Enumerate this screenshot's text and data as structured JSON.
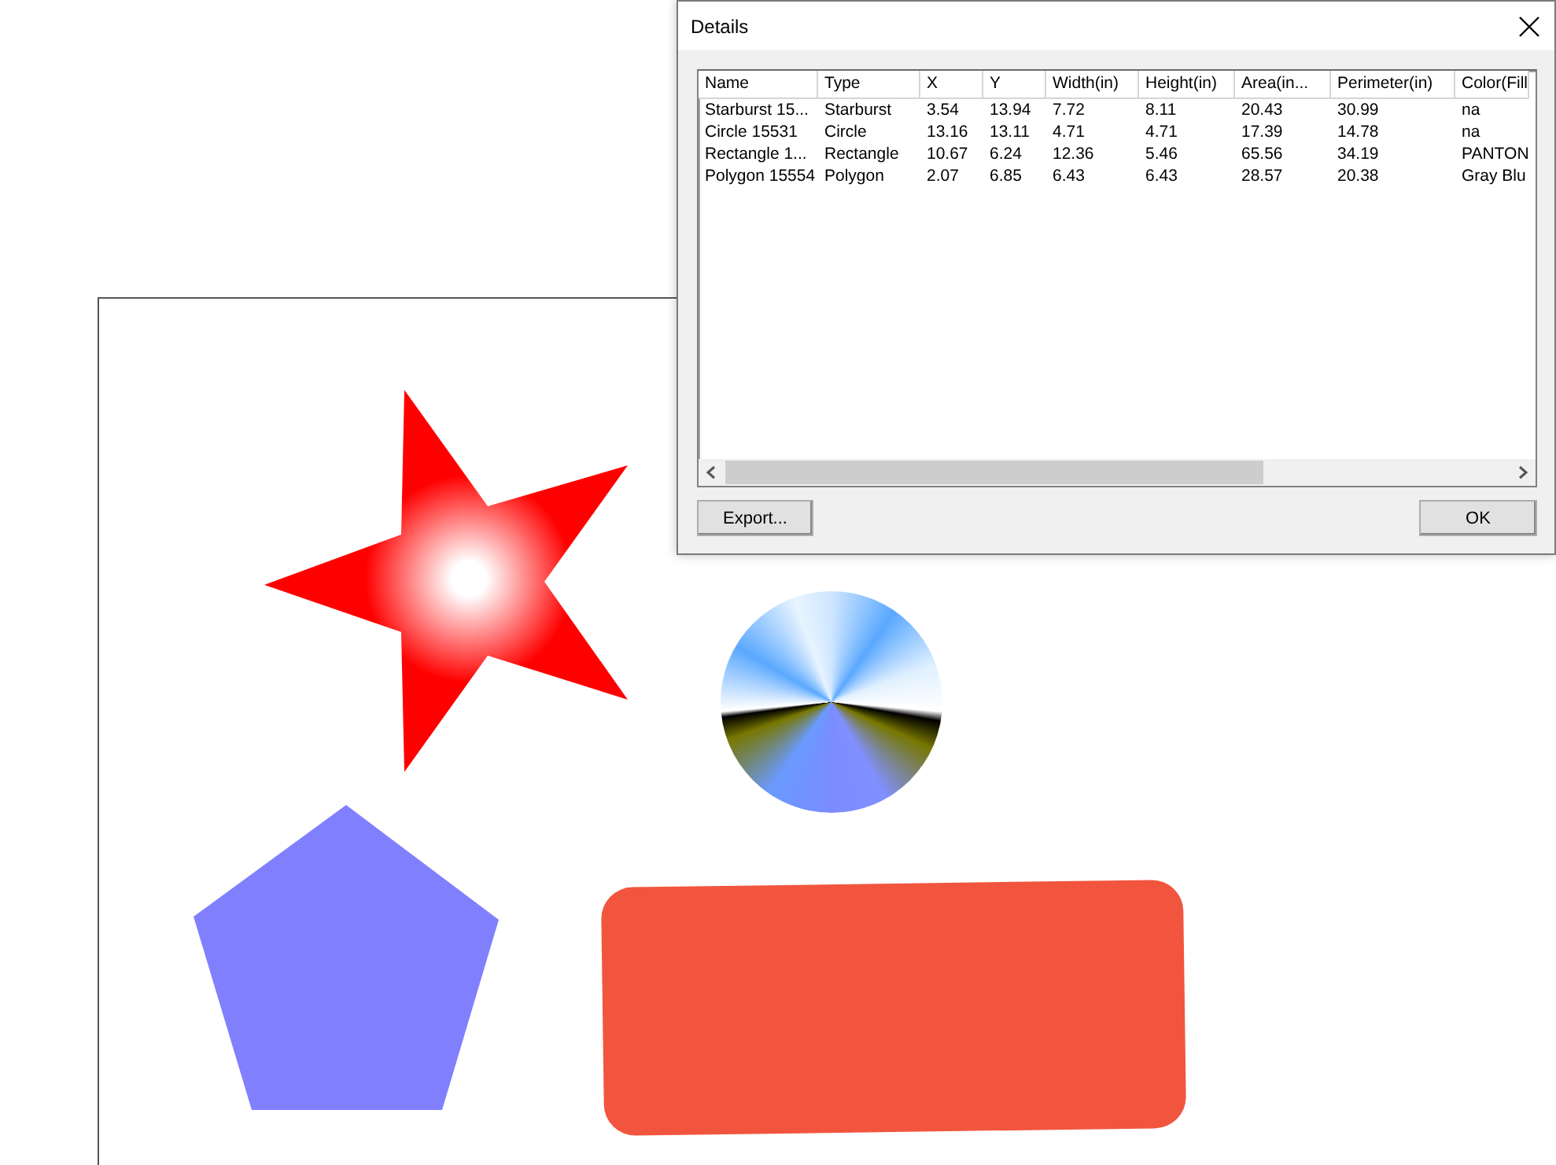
{
  "dialog": {
    "title": "Details",
    "table": {
      "columns": [
        "Name",
        "Type",
        "X",
        "Y",
        "Width(in)",
        "Height(in)",
        "Area(in...",
        "Perimeter(in)",
        "Color(Fill"
      ],
      "rows": [
        [
          "Starburst 15...",
          "Starburst",
          "3.54",
          "13.94",
          "7.72",
          "8.11",
          "20.43",
          "30.99",
          "na"
        ],
        [
          "Circle 15531",
          "Circle",
          "13.16",
          "13.11",
          "4.71",
          "4.71",
          "17.39",
          "14.78",
          "na"
        ],
        [
          "Rectangle 1...",
          "Rectangle",
          "10.67",
          "6.24",
          "12.36",
          "5.46",
          "65.56",
          "34.19",
          "PANTON"
        ],
        [
          "Polygon 15554",
          "Polygon",
          "2.07",
          "6.85",
          "6.43",
          "6.43",
          "28.57",
          "20.38",
          "Gray Blu"
        ]
      ]
    },
    "buttons": [
      {
        "kind": "export",
        "label": "Export..."
      },
      {
        "kind": "ok",
        "label": "OK"
      }
    ]
  }
}
